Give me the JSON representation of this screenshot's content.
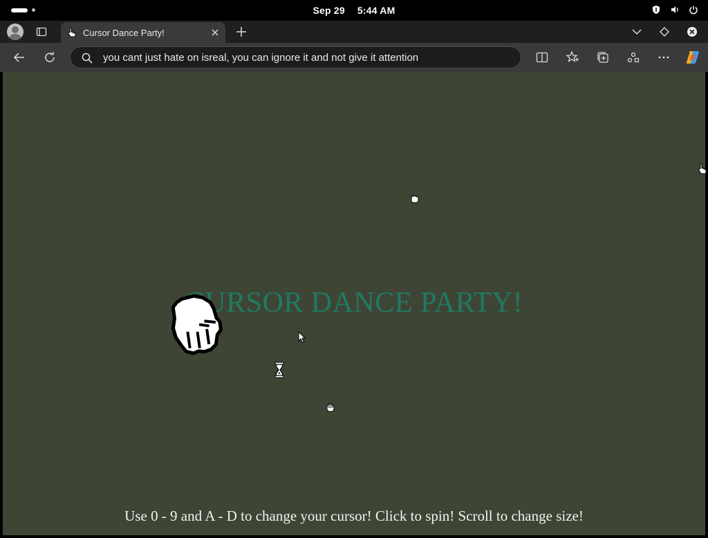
{
  "status_bar": {
    "date": "Sep 29",
    "time": "5:44 AM",
    "icons": [
      "shield-icon",
      "volume-icon",
      "power-icon"
    ]
  },
  "tab_bar": {
    "active_tab": {
      "title": "Cursor Dance Party!",
      "favicon": "hand-cursor-icon"
    },
    "icons": [
      "profile-avatar",
      "tab-actions-icon",
      "close-tab-icon",
      "new-tab-icon",
      "tab-list-chevron-icon",
      "diamond-icon",
      "window-close-icon"
    ]
  },
  "nav_bar": {
    "address_value": "you cant just hate on isreal, you can ignore it and not give it attention",
    "icons": [
      "back-icon",
      "reload-icon",
      "search-icon",
      "split-screen-icon",
      "favorites-icon",
      "collections-icon",
      "share-icon",
      "more-icon",
      "copilot-icon"
    ]
  },
  "page": {
    "background": "#3e4534",
    "title": "CURSOR DANCE PARTY!",
    "title_color": "#1f7a64",
    "instructions": "Use 0 - 9 and A - D to change your cursor! Click to spin! Scroll to change size!",
    "cursors": [
      "hand-cursor-icon",
      "grab-cursor-icon",
      "big-grab-cursor-icon",
      "arrow-cursor-icon",
      "hourglass-cursor-icon",
      "open-hand-cursor-icon"
    ]
  }
}
